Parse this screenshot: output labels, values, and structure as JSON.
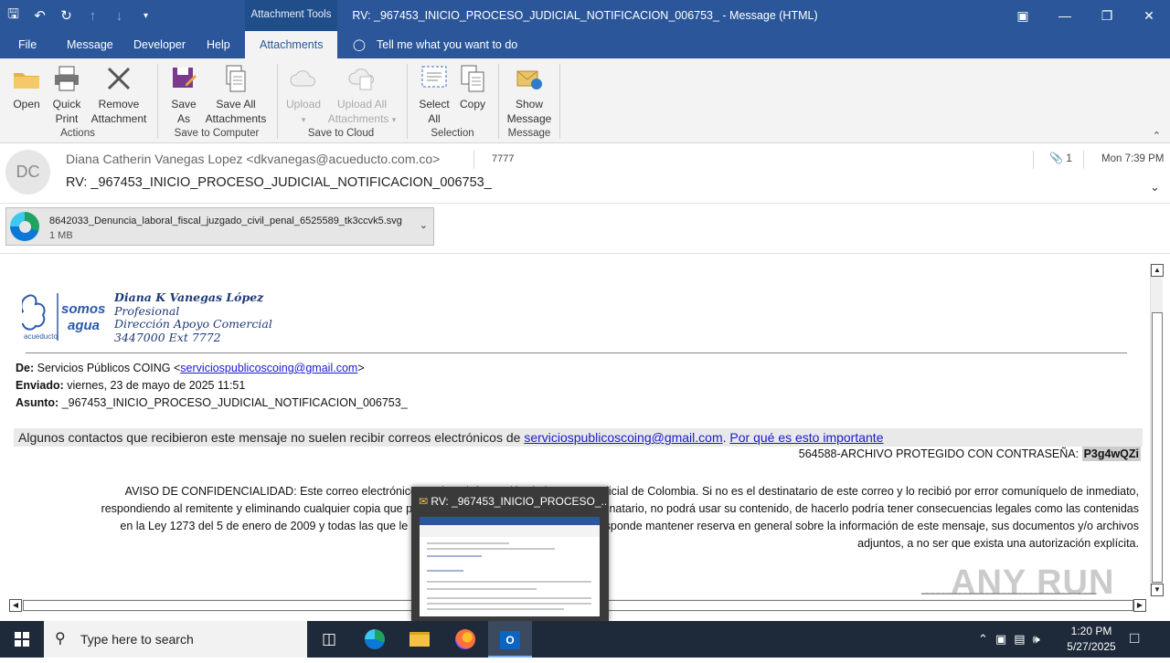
{
  "window": {
    "title": "RV: _967453_INICIO_PROCESO_JUDICIAL_NOTIFICACION_006753_  -  Message (HTML)",
    "context_tab": "Attachment Tools"
  },
  "tabs": [
    {
      "label": "File"
    },
    {
      "label": "Message"
    },
    {
      "label": "Developer"
    },
    {
      "label": "Help"
    },
    {
      "label": "Attachments"
    }
  ],
  "tell_me": "Tell me what you want to do",
  "ribbon": {
    "open": "Open",
    "quick_print": [
      "Quick",
      "Print"
    ],
    "remove_attachment": [
      "Remove",
      "Attachment"
    ],
    "group_actions": "Actions",
    "save_as": [
      "Save",
      "As"
    ],
    "save_all": [
      "Save All",
      "Attachments"
    ],
    "group_save_computer": "Save to Computer",
    "upload": "Upload",
    "upload_all": [
      "Upload All",
      "Attachments"
    ],
    "group_save_cloud": "Save to Cloud",
    "select_all": [
      "Select",
      "All"
    ],
    "copy": "Copy",
    "group_selection": "Selection",
    "show_message": [
      "Show",
      "Message"
    ],
    "group_message": "Message"
  },
  "header": {
    "initials": "DC",
    "from": "Diana Catherin Vanegas Lopez <dkvanegas@acueducto.com.co>",
    "tag": "7777",
    "attachment_count": "1",
    "date": "Mon 7:39 PM",
    "subject": "RV: _967453_INICIO_PROCESO_JUDICIAL_NOTIFICACION_006753_"
  },
  "attachment": {
    "name": "8642033_Denuncia_laboral_fiscal_juzgado_civil_penal_6525589_tk3ccvk5.svg",
    "size": "1 MB"
  },
  "body": {
    "logo_text": [
      "somos",
      "agua",
      "acueducto"
    ],
    "signature": [
      "Diana K Vanegas López",
      "Profesional",
      "Dirección Apoyo Comercial",
      "3447000  Ext 7772"
    ],
    "de_label": "De:",
    "de_name": "Servicios Públicos COING <",
    "de_email": "serviciospublicoscoing@gmail.com",
    "de_close": ">",
    "enviado_label": "Enviado:",
    "enviado_value": "viernes, 23 de mayo de 2025 11:51",
    "asunto_label": "Asunto:",
    "asunto_value": "_967453_INICIO_PROCESO_JUDICIAL_NOTIFICACION_006753_",
    "warning_text": "Algunos contactos que recibieron este mensaje no suelen recibir correos electrónicos de ",
    "warning_email": "serviciospublicoscoing@gmail.com",
    "warning_sep": ". ",
    "warning_link": "Por qué es esto importante",
    "password_label": "564588-ARCHIVO PROTEGIDO CON CONTRASEÑA: ",
    "password_value": "P3g4wQZi",
    "confidential": [
      "AVISO DE CONFIDENCIALIDAD: Este correo electrónico contiene información de la Rama Judicial de Colombia. Si no es el destinatario de este correo y lo recibió por error comuníquelo de inmediato,",
      "respondiendo al remitente y eliminando cualquier copia que pueda tener del mismo. Si no es el destinatario, no podrá usar su contenido, de hacerlo podría tener consecuencias legales como las contenidas",
      "en la Ley 1273 del 5 de enero de 2009 y todas las que le apliquen. Si es el destinatario, le corresponde mantener reserva en general sobre la información de este mensaje, sus documentos y/o archivos",
      "adjuntos, a no ser que exista una autorización explícita."
    ],
    "underline": "________________________________"
  },
  "watermark": "ANY RUN",
  "taskbar_preview": {
    "title": "RV: _967453_INICIO_PROCESO_..."
  },
  "taskbar": {
    "search_placeholder": "Type here to search",
    "time": "1:20 PM",
    "date": "5/27/2025"
  }
}
